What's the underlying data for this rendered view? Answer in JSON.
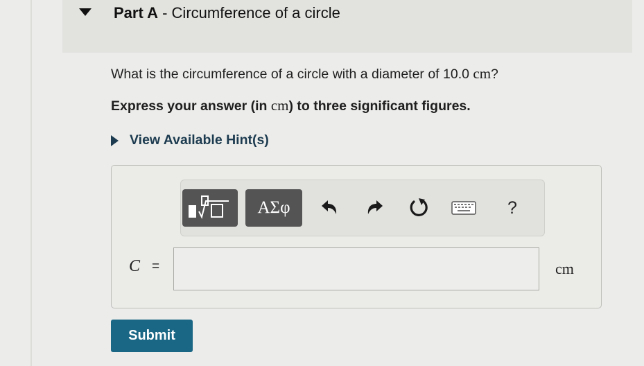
{
  "part": {
    "label": "Part A",
    "separator": " - ",
    "title": "Circumference of a circle"
  },
  "question": {
    "text_before": "What is the circumference of a circle with a diameter of 10.0 ",
    "unit": "cm",
    "text_after": "?"
  },
  "instruction": {
    "before": "Express your answer (in ",
    "unit": "cm",
    "after": ") to three significant figures."
  },
  "hint": {
    "label": "View Available Hint(s)"
  },
  "toolbar": {
    "symbols_label": "ΑΣφ",
    "help_label": "?",
    "icons": [
      "templates-icon",
      "undo-icon",
      "redo-icon",
      "reset-icon",
      "keyboard-icon"
    ]
  },
  "answer": {
    "variable": "C",
    "equals": "=",
    "value": "",
    "unit": "cm"
  },
  "submit": {
    "label": "Submit"
  },
  "colors": {
    "page_bg": "#ecedea",
    "header_bg": "#e2e3df",
    "link": "#1d3b50",
    "toolbar_button": "#545454",
    "submit_bg": "#1a6685"
  }
}
